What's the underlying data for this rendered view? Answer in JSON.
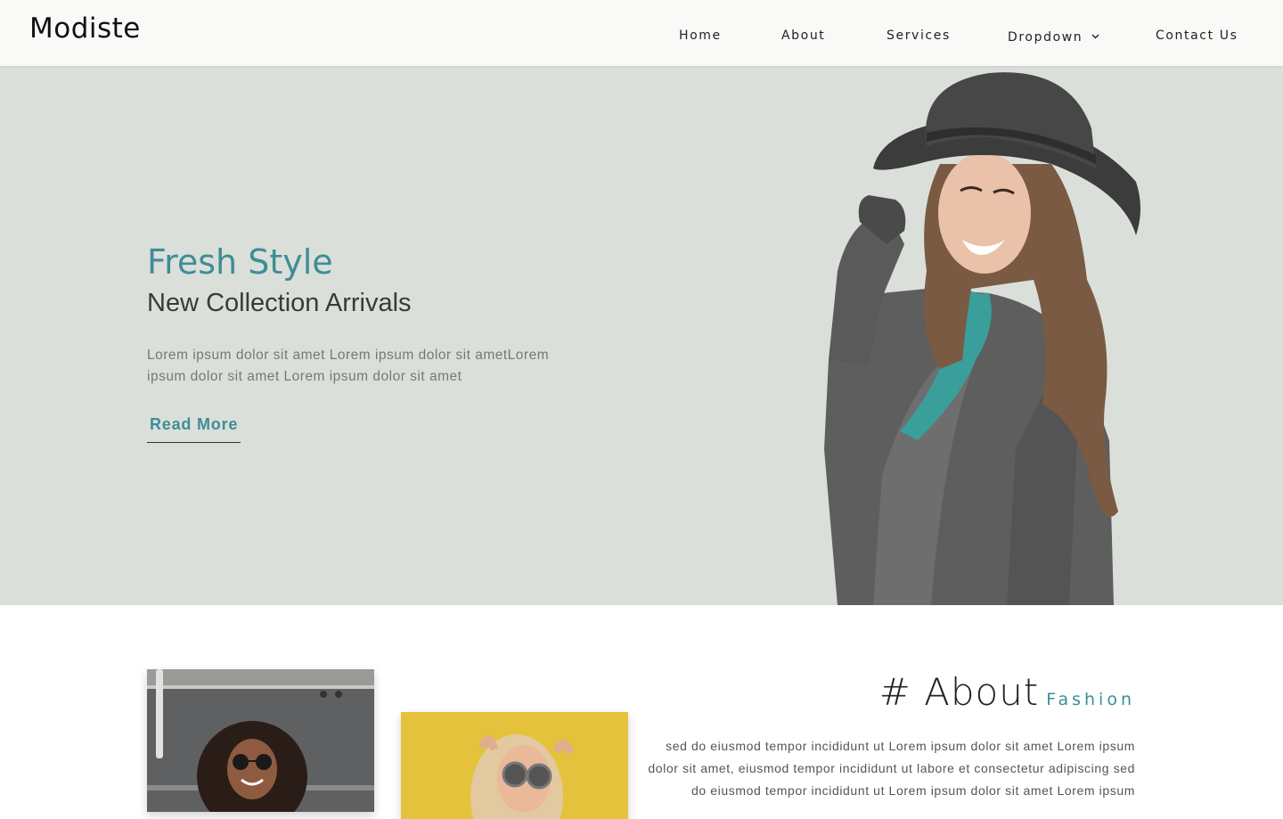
{
  "brand": {
    "name": "Modiste"
  },
  "nav": {
    "items": [
      {
        "label": "Home"
      },
      {
        "label": "About"
      },
      {
        "label": "Services"
      },
      {
        "label": "Dropdown",
        "icon": "chevron-down-icon"
      },
      {
        "label": "Contact Us"
      }
    ]
  },
  "hero": {
    "title": "Fresh Style",
    "subtitle": "New Collection Arrivals",
    "text": "Lorem ipsum dolor sit amet Lorem ipsum dolor sit ametLorem ipsum dolor sit amet Lorem ipsum dolor sit amet",
    "button_label": "Read More"
  },
  "about": {
    "heading": "# About",
    "heading_accent": "Fashion",
    "paragraph": "sed do eiusmod tempor incididunt ut Lorem ipsum dolor sit amet Lorem ipsum dolor sit amet, eiusmod tempor incididunt ut labore et consectetur adipiscing sed do eiusmod tempor incididunt ut Lorem ipsum dolor sit amet Lorem ipsum"
  },
  "colors": {
    "accent": "#3d8e96",
    "hero_background": "#dbdfda",
    "header_background": "#f9f9f7"
  }
}
